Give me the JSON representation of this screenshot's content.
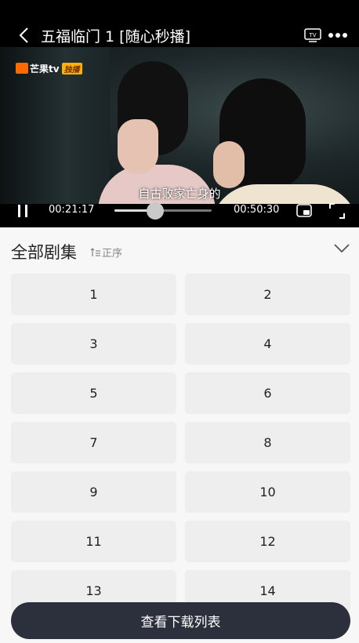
{
  "header": {
    "title": "五福临门 1 [随心秒播]",
    "icons": {
      "back": "chevron-left-icon",
      "tv": "tv-cast-icon",
      "more": "more-dots-icon"
    }
  },
  "player": {
    "logo_text": "芒果tv",
    "logo_badge": "独播",
    "subtitle": "自古败家亡身的",
    "current_time": "00:21:17",
    "total_time": "00:50:30",
    "progress": 0.42,
    "state": "playing"
  },
  "episodes": {
    "title": "全部剧集",
    "sort_label": "正序",
    "items": [
      "1",
      "2",
      "3",
      "4",
      "5",
      "6",
      "7",
      "8",
      "9",
      "10",
      "11",
      "12",
      "13",
      "14"
    ]
  },
  "footer": {
    "download_list_label": "查看下载列表"
  },
  "colors": {
    "accent": "#2c303d",
    "logo": "#ff6a00",
    "badge": "#ffb300"
  }
}
